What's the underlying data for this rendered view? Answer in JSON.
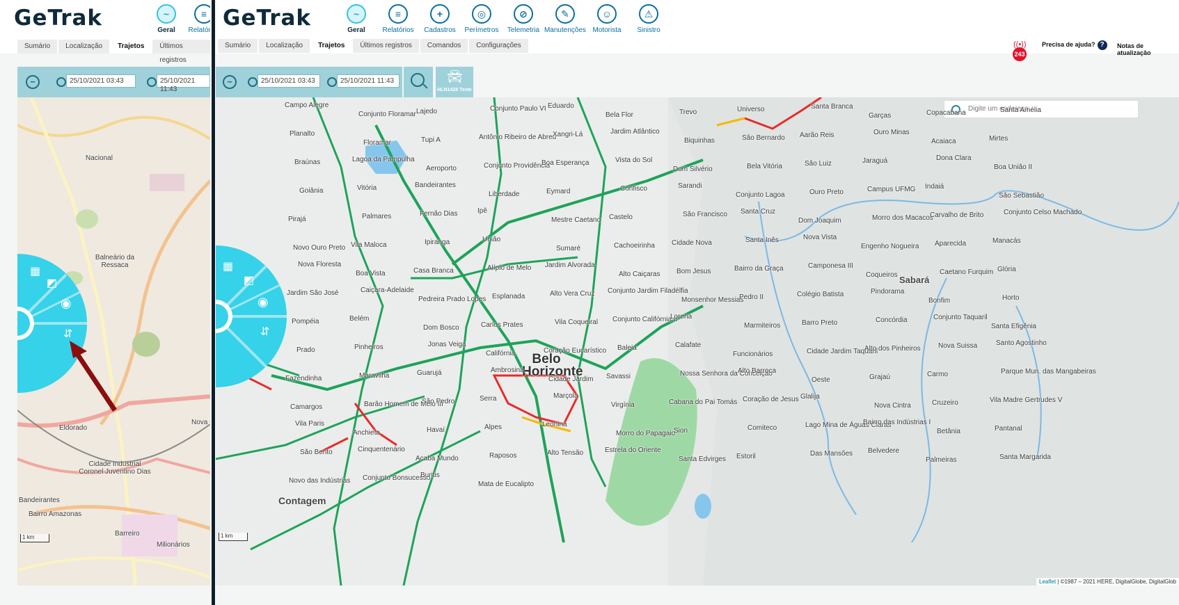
{
  "brand": {
    "logo": "GeTrak"
  },
  "left": {
    "nav": [
      {
        "label": "Geral",
        "icon": "chart-icon",
        "active": true
      },
      {
        "label": "Relatórios",
        "icon": "report-icon"
      }
    ],
    "tabs": [
      "Sumário",
      "Localização",
      "Trajetos",
      "Últimos registros"
    ],
    "active_tab": "Trajetos",
    "date_start": "25/10/2021 03:43",
    "date_end": "25/10/2021 11:43",
    "scale": "1 km",
    "places": [
      "Nacional",
      "Balneário da Ressaca",
      "Eldorado",
      "Cidade Industrial Coronel Juventino Dias",
      "Bandeirantes",
      "Bairro Amazonas",
      "Barreiro",
      "Milionários",
      "Nova C"
    ]
  },
  "right": {
    "nav": [
      {
        "label": "Geral",
        "icon": "chart-icon",
        "active": true
      },
      {
        "label": "Relatórios",
        "icon": "report-icon"
      },
      {
        "label": "Cadastros",
        "icon": "folder-plus-icon"
      },
      {
        "label": "Perímetros",
        "icon": "target-icon"
      },
      {
        "label": "Telemetria",
        "icon": "compass-icon"
      },
      {
        "label": "Manutenções",
        "icon": "wrench-icon"
      },
      {
        "label": "Motorista",
        "icon": "driver-icon"
      },
      {
        "label": "Sinistro",
        "icon": "alarm-icon"
      }
    ],
    "tabs": [
      "Sumário",
      "Localização",
      "Trajetos",
      "Últimos registros",
      "Comandos",
      "Configurações"
    ],
    "active_tab": "Trajetos",
    "notif_count": "243",
    "help_label": "Precisa de ajuda?",
    "help_icon": "?",
    "updates_label": "Notas de atualização",
    "date_start": "25/10/2021 03:43",
    "date_end": "25/10/2021 11:43",
    "vehicle_label": "HLN1428 Teste",
    "search_placeholder": "Digite um endereço...",
    "scale": "1 km",
    "attribution_link": "Leaflet",
    "attribution_text": " | ©1987 – 2021 HERE, DigitalGlobe, DigitalGlob",
    "places": {
      "city": "Belo Horizonte",
      "contagem": "Contagem",
      "sabara": "Sabará",
      "small": [
        "Campo Alegre",
        "Conjunto Floramar",
        "Lajedo",
        "Conjunto Paulo VI",
        "Eduardo",
        "Bela Flor",
        "Trevo",
        "Universo",
        "Santa Branca",
        "Garças",
        "Copacabana",
        "Santa Amélia",
        "Planalto",
        "Floramar",
        "Tupi A",
        "Antônio Ribeiro de Abreu",
        "Xangri-Lá",
        "Jardim Atlântico",
        "Biquinhas",
        "São Bernardo",
        "Aarão Reis",
        "Ouro Minas",
        "Acaiaca",
        "Mirtes",
        "Braúnas",
        "Lagoa da Pampulha",
        "Aeroporto",
        "Conjunto Providência",
        "Boa Esperança",
        "Vista do Sol",
        "Dom Silvério",
        "Bela Vitória",
        "São Luiz",
        "Jaraguá",
        "Dona Clara",
        "Boa União II",
        "Goiânia",
        "Vitória",
        "Bandeirantes",
        "Liberdade",
        "Eymard",
        "Confisco",
        "Sarandi",
        "Conjunto Lagoa",
        "Ouro Preto",
        "Campus UFMG",
        "Indaiá",
        "São Sebastião",
        "Pirajá",
        "Palmares",
        "Fernão Dias",
        "Ipê",
        "Mestre Caetano",
        "Castelo",
        "São Francisco",
        "Santa Cruz",
        "Dom Joaquim",
        "Morro dos Macacos",
        "Carvalho de Brito",
        "Conjunto Celso Machado",
        "Novo Ouro Preto",
        "Vila Maloca",
        "Ipiranga",
        "União",
        "Sumaré",
        "Cachoeirinha",
        "Cidade Nova",
        "Santa Inês",
        "Nova Vista",
        "Engenho Nogueira",
        "Aparecida",
        "Manacás",
        "Nova Floresta",
        "Boa Vista",
        "Casa Branca",
        "Alípio de Melo",
        "Jardim Alvorada",
        "Alto Caiçaras",
        "Bom Jesus",
        "Bairro da Graça",
        "Camponesa III",
        "Coqueiros",
        "Caetano Furquim",
        "Glória",
        "Jardim São José",
        "Caiçara-Adelaide",
        "Pedreira Prado Lopes",
        "Esplanada",
        "Alto Vera Cruz",
        "Conjunto Jardim Filadélfia",
        "Monsenhor Messias",
        "Pedro II",
        "Colégio Batista",
        "Pindorama",
        "Bonfim",
        "Horto",
        "Pompéia",
        "Belém",
        "Dom Bosco",
        "Carlos Prates",
        "Vila Coqueiral",
        "Conjunto Califórnia II",
        "Lorena",
        "Marmiteiros",
        "Barro Preto",
        "Concórdia",
        "Conjunto Taquaril",
        "Santa Efigênia",
        "Prado",
        "Pinheiros",
        "Jonas Veiga",
        "Califórnia",
        "Coração Eucarístico",
        "Baleia",
        "Calafate",
        "Funcionários",
        "Cidade Jardim Taquaril",
        "Alto dos Pinheiros",
        "Nova Suissa",
        "Santo Agostinho",
        "Fazendinha",
        "Maravilha",
        "Guarujá",
        "Ambrosina",
        "Cidade Jardim",
        "Savassi",
        "Nossa Senhora da Conceição",
        "Alto Barroca",
        "Oeste",
        "Grajaú",
        "Carmo",
        "Parque Mun. das Mangabeiras",
        "Camargos",
        "Barão Homem de Melo III",
        "São Pedro",
        "Serra",
        "Marçola",
        "Virgínia",
        "Cabana do Pai Tomás",
        "Coração de Jesus",
        "Glalija",
        "Nova Cintra",
        "Cruzeiro",
        "Vila Madre Gertrudes V",
        "Vila Paris",
        "Anchieta",
        "Havaí",
        "Alpes",
        "Leonina",
        "Morro do Papagaio",
        "Sion",
        "Comiteco",
        "Lago Mina de Águas Claras",
        "Bairro das Indústrias I",
        "Betânia",
        "Pantanal",
        "São Bento",
        "Cinquentenário",
        "Acaba Mundo",
        "Raposos",
        "Alto Tensão",
        "Estrela do Oriente",
        "Santa Edvirges",
        "Estoril",
        "Das Mansões",
        "Belvedere",
        "Palmeiras",
        "Santa Margarida",
        "Novo das Indústrias",
        "Conjunto Bonsucesso",
        "Buritis",
        "Mata de Eucalipto"
      ]
    }
  }
}
